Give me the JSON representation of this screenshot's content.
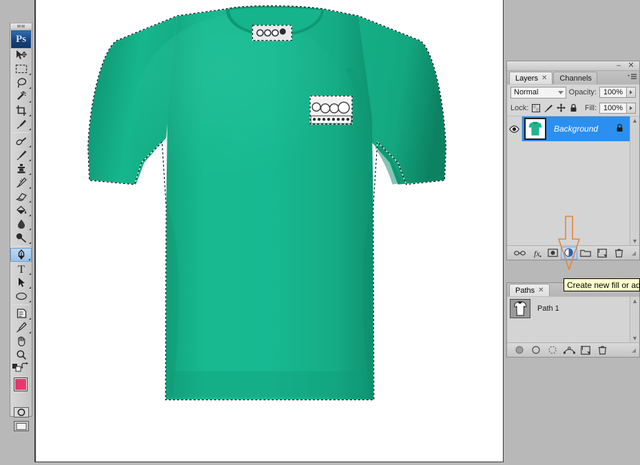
{
  "app": {
    "name": "Photoshop",
    "logo_text": "Ps"
  },
  "toolbar": {
    "grip": "▪▪",
    "tools": [
      {
        "name": "move-tool",
        "label": "Move Tool",
        "selected": false,
        "has_corner": false
      },
      {
        "name": "rectangular-marquee-tool",
        "label": "Rectangular Marquee Tool",
        "selected": false,
        "has_corner": true
      },
      {
        "name": "lasso-tool",
        "label": "Lasso Tool",
        "selected": false,
        "has_corner": true
      },
      {
        "name": "magic-wand-tool",
        "label": "Magic Wand Tool",
        "selected": false,
        "has_corner": true
      },
      {
        "name": "crop-tool",
        "label": "Crop Tool",
        "selected": false,
        "has_corner": true
      },
      {
        "name": "eyedropper-tool",
        "label": "Eyedropper Tool",
        "selected": false,
        "has_corner": true
      },
      {
        "name": "healing-brush-tool",
        "label": "Spot Healing Brush Tool",
        "selected": false,
        "has_corner": true
      },
      {
        "name": "brush-tool",
        "label": "Brush Tool",
        "selected": false,
        "has_corner": true
      },
      {
        "name": "clone-stamp-tool",
        "label": "Clone Stamp Tool",
        "selected": false,
        "has_corner": true
      },
      {
        "name": "history-brush-tool",
        "label": "History Brush Tool",
        "selected": false,
        "has_corner": true
      },
      {
        "name": "eraser-tool",
        "label": "Eraser Tool",
        "selected": false,
        "has_corner": true
      },
      {
        "name": "gradient-paint-bucket-tool",
        "label": "Paint Bucket Tool",
        "selected": false,
        "has_corner": true
      },
      {
        "name": "blur-tool",
        "label": "Blur Tool",
        "selected": false,
        "has_corner": true
      },
      {
        "name": "dodge-tool",
        "label": "Dodge Tool",
        "selected": false,
        "has_corner": true
      },
      {
        "name": "pen-tool",
        "label": "Pen Tool",
        "selected": true,
        "has_corner": true
      },
      {
        "name": "type-tool",
        "label": "Horizontal Type Tool",
        "selected": false,
        "has_corner": true
      },
      {
        "name": "path-selection-tool",
        "label": "Path Selection Tool",
        "selected": false,
        "has_corner": true
      },
      {
        "name": "ellipse-shape-tool",
        "label": "Ellipse Tool",
        "selected": false,
        "has_corner": true
      },
      {
        "name": "notes-tool",
        "label": "Note Tool",
        "selected": false,
        "has_corner": true
      },
      {
        "name": "color-sampler-tool",
        "label": "Color Sampler Tool",
        "selected": false,
        "has_corner": true
      },
      {
        "name": "hand-tool",
        "label": "Hand Tool",
        "selected": false,
        "has_corner": false
      },
      {
        "name": "zoom-tool",
        "label": "Zoom Tool",
        "selected": false,
        "has_corner": false
      }
    ],
    "colors": {
      "foreground": "#e8386b",
      "background": "#000000",
      "default_colors_label": "Default Foreground and Background Colors",
      "swap_label": "Switch Foreground and Background Colors"
    },
    "modes": [
      {
        "name": "quick-mask-mode-button",
        "label": "Edit in Quick Mask Mode"
      },
      {
        "name": "screen-mode-button",
        "label": "Change Screen Mode"
      }
    ]
  },
  "panel_window": {
    "minimize_label": "–",
    "close_label": "✕"
  },
  "layers_panel": {
    "tabs": [
      {
        "label": "Layers",
        "active": true,
        "closable": true
      },
      {
        "label": "Channels",
        "active": false,
        "closable": false
      }
    ],
    "blend_mode": "Normal",
    "opacity_label": "Opacity:",
    "opacity_value": "100%",
    "lock_label": "Lock:",
    "fill_label": "Fill:",
    "fill_value": "100%",
    "lock_icons": [
      "lock-transparent-pixels",
      "lock-image-pixels",
      "lock-position",
      "lock-all"
    ],
    "layers": [
      {
        "name": "Background",
        "visible": true,
        "locked": true,
        "selected": true
      }
    ],
    "footer_buttons": [
      {
        "name": "link-layers-button",
        "label": "Link layers",
        "highlighted": false
      },
      {
        "name": "layer-style-button",
        "label": "Add a layer style",
        "highlighted": false
      },
      {
        "name": "layer-mask-button",
        "label": "Add layer mask",
        "highlighted": false
      },
      {
        "name": "new-fill-adjustment-layer-button",
        "label": "Create new fill or adjustment layer",
        "highlighted": true
      },
      {
        "name": "new-group-button",
        "label": "Create a new group",
        "highlighted": false
      },
      {
        "name": "new-layer-button",
        "label": "Create a new layer",
        "highlighted": false
      },
      {
        "name": "delete-layer-button",
        "label": "Delete layer",
        "highlighted": false
      }
    ]
  },
  "paths_panel": {
    "tabs": [
      {
        "label": "Paths",
        "active": true,
        "closable": true
      }
    ],
    "paths": [
      {
        "name": "Path 1",
        "selected": false
      }
    ],
    "footer_buttons": [
      {
        "name": "fill-path-button",
        "label": "Fill path with foreground color"
      },
      {
        "name": "stroke-path-button",
        "label": "Stroke path with brush"
      },
      {
        "name": "load-path-as-selection-button",
        "label": "Load path as a selection"
      },
      {
        "name": "make-work-path-button",
        "label": "Make work path from selection"
      },
      {
        "name": "new-path-button",
        "label": "Create new path"
      },
      {
        "name": "delete-path-button",
        "label": "Delete current path"
      }
    ]
  },
  "tooltip": {
    "text": "Create new fill or adjustment layer",
    "visible_text": "Create new fill or adju"
  },
  "annotation": {
    "arrow_color": "#e8823c",
    "arrow_label": "points-to-create-new-fill-or-adjustment-layer"
  },
  "canvas": {
    "document_background": "#ffffff",
    "artwork_name": "green t-shirt with marching ants selection",
    "shirt_color": "#17b48a",
    "shirt_shadow_color": "#119a77",
    "collar_tag_label": "neck label",
    "chest_graphic_label": "chest logo graphic",
    "selection_active": true
  }
}
